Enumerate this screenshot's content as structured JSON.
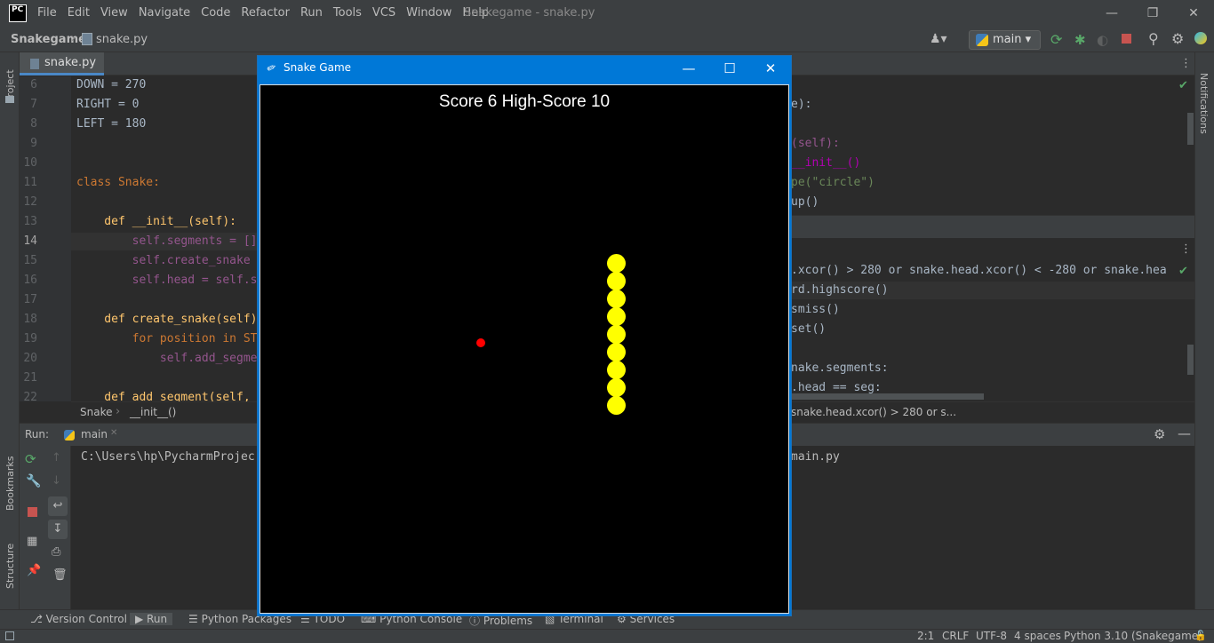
{
  "window": {
    "title": "Snakegame - snake.py",
    "logo": "PC"
  },
  "menu": [
    "File",
    "Edit",
    "View",
    "Navigate",
    "Code",
    "Refactor",
    "Run",
    "Tools",
    "VCS",
    "Window",
    "Help"
  ],
  "nav": {
    "project": "Snakegame",
    "file": "snake.py",
    "run_config": "main"
  },
  "editor": {
    "tab": "snake.py",
    "lines": [
      {
        "n": "6",
        "text": "DOWN = 270"
      },
      {
        "n": "7",
        "text": "RIGHT = 0"
      },
      {
        "n": "8",
        "text": "LEFT = 180"
      },
      {
        "n": "9",
        "text": ""
      },
      {
        "n": "10",
        "text": ""
      },
      {
        "n": "11",
        "text": "class Snake:"
      },
      {
        "n": "12",
        "text": ""
      },
      {
        "n": "13",
        "text": "    def __init__(self):"
      },
      {
        "n": "14",
        "text": "        self.segments = []"
      },
      {
        "n": "15",
        "text": "        self.create_snake"
      },
      {
        "n": "16",
        "text": "        self.head = self.s"
      },
      {
        "n": "17",
        "text": ""
      },
      {
        "n": "18",
        "text": "    def create_snake(self)"
      },
      {
        "n": "19",
        "text": "        for position in ST"
      },
      {
        "n": "20",
        "text": "            self.add_segme"
      },
      {
        "n": "21",
        "text": ""
      },
      {
        "n": "22",
        "text": "    def add_segment(self,"
      }
    ],
    "breadcrumb": [
      "Snake",
      "__init__()"
    ]
  },
  "right_editor": {
    "top_lines": [
      "e):",
      "",
      "(self):",
      "__init__()",
      "pe(\"circle\")",
      "up()"
    ],
    "bottom_lines": [
      ".xcor() > 280 or snake.head.xcor() < -280 or snake.hea",
      "rd.highscore()",
      "smiss()",
      "set()",
      "",
      "nake.segments:",
      ".head == seg:"
    ],
    "breadcrumb": "snake.head.xcor() > 280 or s..."
  },
  "run": {
    "label": "Run:",
    "tab": "main",
    "output_left": "C:\\Users\\hp\\PycharmProjec",
    "output_right": "main.py"
  },
  "side_labels": {
    "project": "Project",
    "bookmarks": "Bookmarks",
    "structure": "Structure",
    "notifications": "Notifications"
  },
  "bottom_tools": [
    "Version Control",
    "Run",
    "Python Packages",
    "TODO",
    "Python Console",
    "Problems",
    "Terminal",
    "Services"
  ],
  "status": {
    "position": "2:1",
    "line_sep": "CRLF",
    "encoding": "UTF-8",
    "indent": "4 spaces",
    "interpreter": "Python 3.10 (Snakegame)"
  },
  "game": {
    "title": "Snake Game",
    "score_text": "Score 6  High-Score 10",
    "snake_length": 9,
    "snake_color": "#ffff00",
    "food_color": "#ff0000"
  }
}
